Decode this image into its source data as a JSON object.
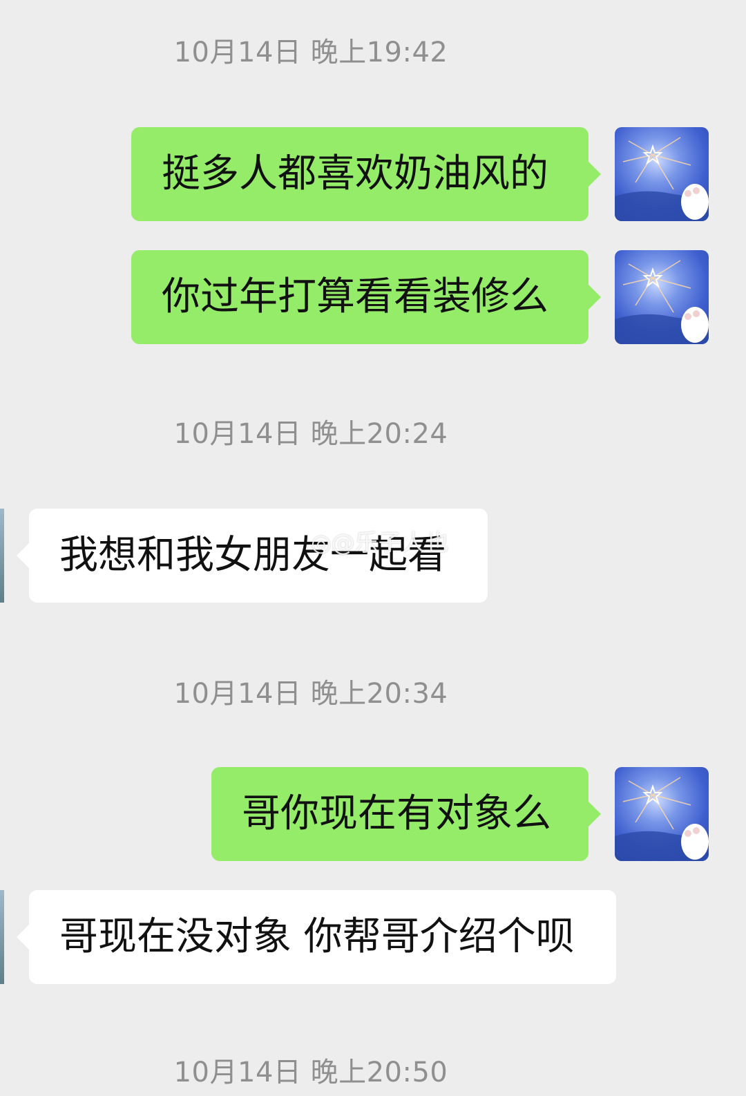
{
  "timestamps": [
    "10月14日 晚上19:42",
    "10月14日 晚上20:24",
    "10月14日 晚上20:34",
    "10月14日 晚上20:50"
  ],
  "messages": [
    {
      "side": "sent",
      "text": "挺多人都喜欢奶油风的"
    },
    {
      "side": "sent",
      "text": "你过年打算看看装修么"
    },
    {
      "side": "received",
      "text": "我想和我女朋友一起看"
    },
    {
      "side": "sent",
      "text": "哥你现在有对象么"
    },
    {
      "side": "received",
      "text": "哥现在没对象 你帮哥介绍个呗"
    }
  ],
  "watermark": "@乐子人也",
  "colors": {
    "background": "#ededed",
    "sent_bubble": "#95ec69",
    "received_bubble": "#ffffff",
    "timestamp_text": "#8f8f8f"
  },
  "icons": {
    "self_avatar": "fireworks-avatar-icon",
    "watermark_logo": "weibo-logo-icon"
  }
}
